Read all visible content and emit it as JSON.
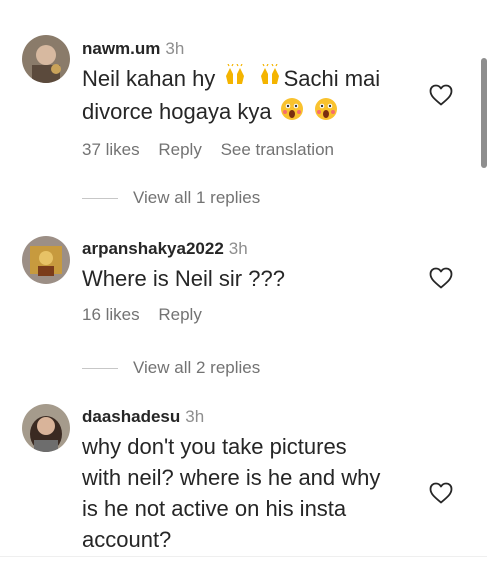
{
  "comments": [
    {
      "username": "nawm.um",
      "time": "3h",
      "text_line1_a": "Neil kahan hy",
      "text_line1_b": "Sachi mai",
      "text_line2_a": "divorce hogaya kya",
      "likes": "37 likes",
      "reply": "Reply",
      "translate": "See translation",
      "replies_label": "View all 1 replies"
    },
    {
      "username": "arpanshakya2022",
      "time": "3h",
      "text": "Where is Neil sir ???",
      "likes": "16 likes",
      "reply": "Reply",
      "replies_label": "View all 2 replies"
    },
    {
      "username": "daashadesu",
      "time": "3h",
      "text_lines": [
        "why don't you take pictures",
        "with neil? where is he and why",
        "is he not active on his insta",
        "account?"
      ]
    }
  ],
  "icons": {
    "heart": "heart-outline-icon",
    "raising_hands": "raising-hands-emoji",
    "astonished": "astonished-face-emoji"
  },
  "colors": {
    "text": "#262626",
    "secondary": "#737373",
    "time": "#8e8e8e"
  }
}
